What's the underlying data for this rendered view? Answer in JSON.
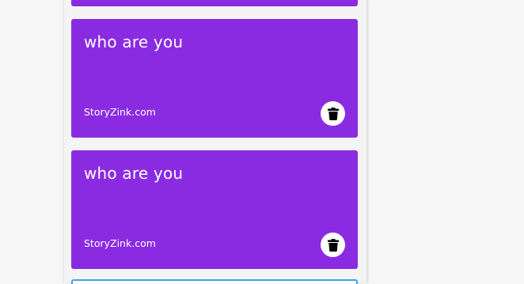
{
  "cards": [
    {
      "title": "who are you",
      "source": "StoryZink.com",
      "delete_icon": "trash-icon"
    },
    {
      "title": "who are you",
      "source": "StoryZink.com",
      "delete_icon": "trash-icon"
    }
  ],
  "colors": {
    "card_background": "#8a2be2",
    "card_text": "#ffffff",
    "delete_button_background": "#ffffff",
    "page_background": "#f6f6f6",
    "bottom_card_border": "#3ea3e8"
  }
}
